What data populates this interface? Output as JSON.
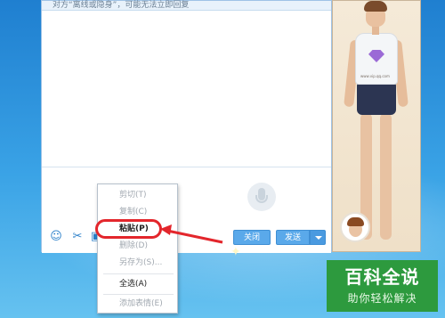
{
  "chat": {
    "notice": "对方“离线或隐身”，可能无法立即回复",
    "close_label": "关闭",
    "send_label": "发送"
  },
  "icons": [
    "emoji-icon",
    "scissors-icon",
    "image-icon",
    "microphone-icon",
    "dropdown-arrow-icon"
  ],
  "context_menu": {
    "items": [
      {
        "label": "剪切(T)",
        "enabled": false
      },
      {
        "label": "复制(C)",
        "enabled": false
      },
      {
        "label": "粘贴(P)",
        "enabled": true
      },
      {
        "label": "删除(D)",
        "enabled": false
      },
      {
        "label": "另存为(S)...",
        "enabled": false
      },
      {
        "label": "全选(A)",
        "enabled": true
      },
      {
        "label": "添加表情(E)",
        "enabled": false
      }
    ]
  },
  "avatar": {
    "shirt_text": "www.vip.qq.com"
  },
  "watermark": {
    "title": "百科全说",
    "subtitle": "助你轻松解决"
  },
  "colors": {
    "desktop_blue": "#2a8fd8",
    "button_blue": "#5aa9ea",
    "highlight_red": "#e3262c",
    "watermark_green": "#2d9a3e"
  }
}
